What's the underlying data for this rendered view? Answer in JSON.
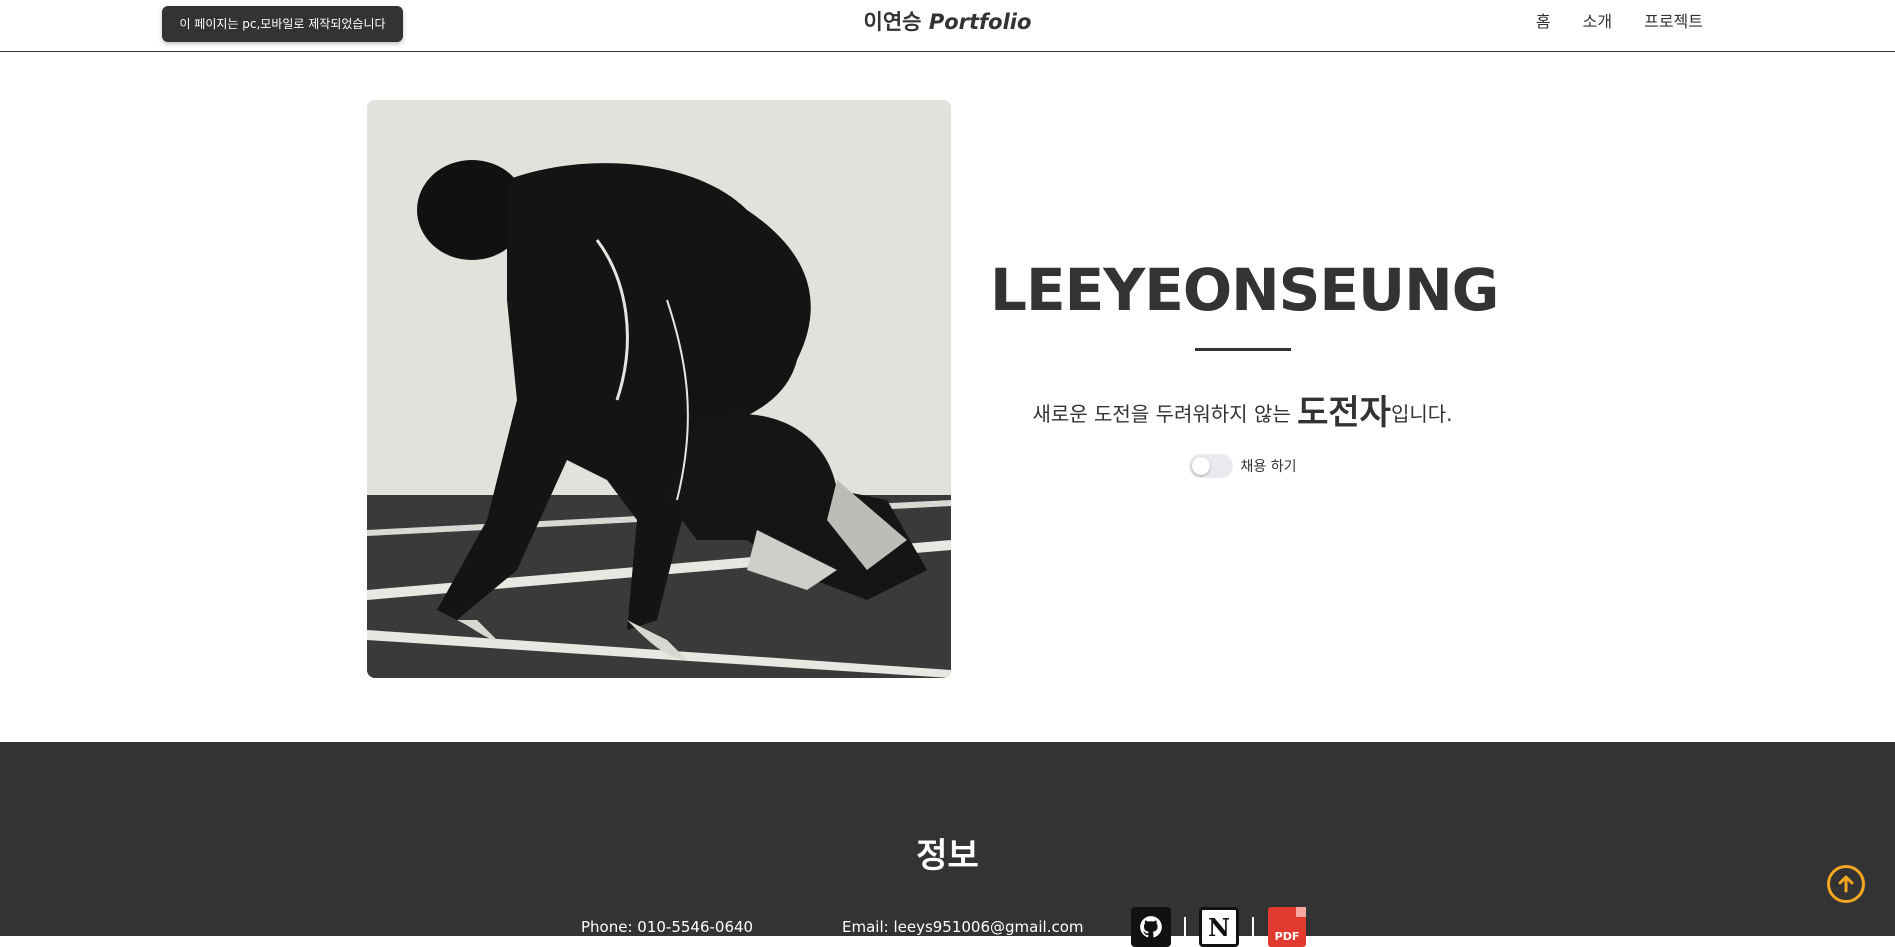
{
  "header": {
    "notice": "이 페이지는 pc,모바일로 제작되었습니다",
    "brand_name": "이연승",
    "brand_suffix": "Portfolio",
    "nav": [
      {
        "label": "홈"
      },
      {
        "label": "소개"
      },
      {
        "label": "프로젝트"
      }
    ]
  },
  "hero": {
    "name": "LEEYEONSEUNG",
    "tagline_before": "새로운 도전을 두려워하지 않는 ",
    "tagline_emphasis": "도전자",
    "tagline_after": "입니다.",
    "hire_label": "채용 하기",
    "hire_toggle_on": false
  },
  "footer": {
    "title": "정보",
    "phone": "Phone: 010-5546-0640",
    "email": "Email: leeys951006@gmail.com",
    "icons": [
      "github-icon",
      "notion-icon",
      "pdf-icon"
    ],
    "pdf_label": "PDF",
    "notion_label": "N"
  },
  "colors": {
    "dark": "#333333",
    "accent": "#f5a623",
    "pdf_red": "#e23a2e"
  }
}
